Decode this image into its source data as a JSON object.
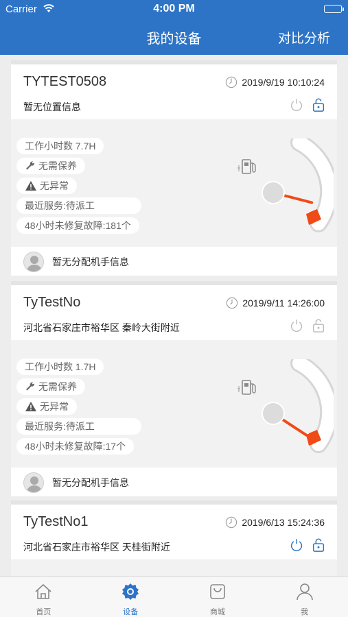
{
  "status_bar": {
    "carrier": "Carrier",
    "time": "4:00 PM"
  },
  "nav": {
    "title": "我的设备",
    "right_action": "对比分析"
  },
  "devices": [
    {
      "name": "TYTEST0508",
      "datetime": "2019/9/19 10:10:24",
      "location": "暂无位置信息",
      "power_icon_active": false,
      "lock_icon_active": true,
      "work_hours": "工作小时数 7.7H",
      "maintenance": "无需保养",
      "abnormal": "无异常",
      "recent_service": "最近服务:待派工",
      "unrepaired": "48小时未修复故障:181个",
      "fuel_level": 0.3,
      "operator": "暂无分配机手信息"
    },
    {
      "name": "TyTestNo",
      "datetime": "2019/9/11 14:26:00",
      "location": "河北省石家庄市裕华区 秦岭大街附近",
      "power_icon_active": false,
      "lock_icon_active": false,
      "work_hours": "工作小时数 1.7H",
      "maintenance": "无需保养",
      "abnormal": "无异常",
      "recent_service": "最近服务:待派工",
      "unrepaired": "48小时未修复故障:17个",
      "fuel_level": 0.08,
      "operator": "暂无分配机手信息"
    },
    {
      "name": "TyTestNo1",
      "datetime": "2019/6/13 15:24:36",
      "location": "河北省石家庄市裕华区 天桂街附近",
      "power_icon_active": true,
      "lock_icon_active": true
    }
  ],
  "tabs": [
    {
      "label": "首页",
      "icon": "home-icon"
    },
    {
      "label": "设备",
      "icon": "gear-icon",
      "active": true
    },
    {
      "label": "商城",
      "icon": "shop-bag-icon"
    },
    {
      "label": "我",
      "icon": "person-icon"
    }
  ],
  "colors": {
    "primary": "#2d74c7",
    "gauge_needle": "#f04a17",
    "inactive_icon": "#bdbdbd"
  }
}
